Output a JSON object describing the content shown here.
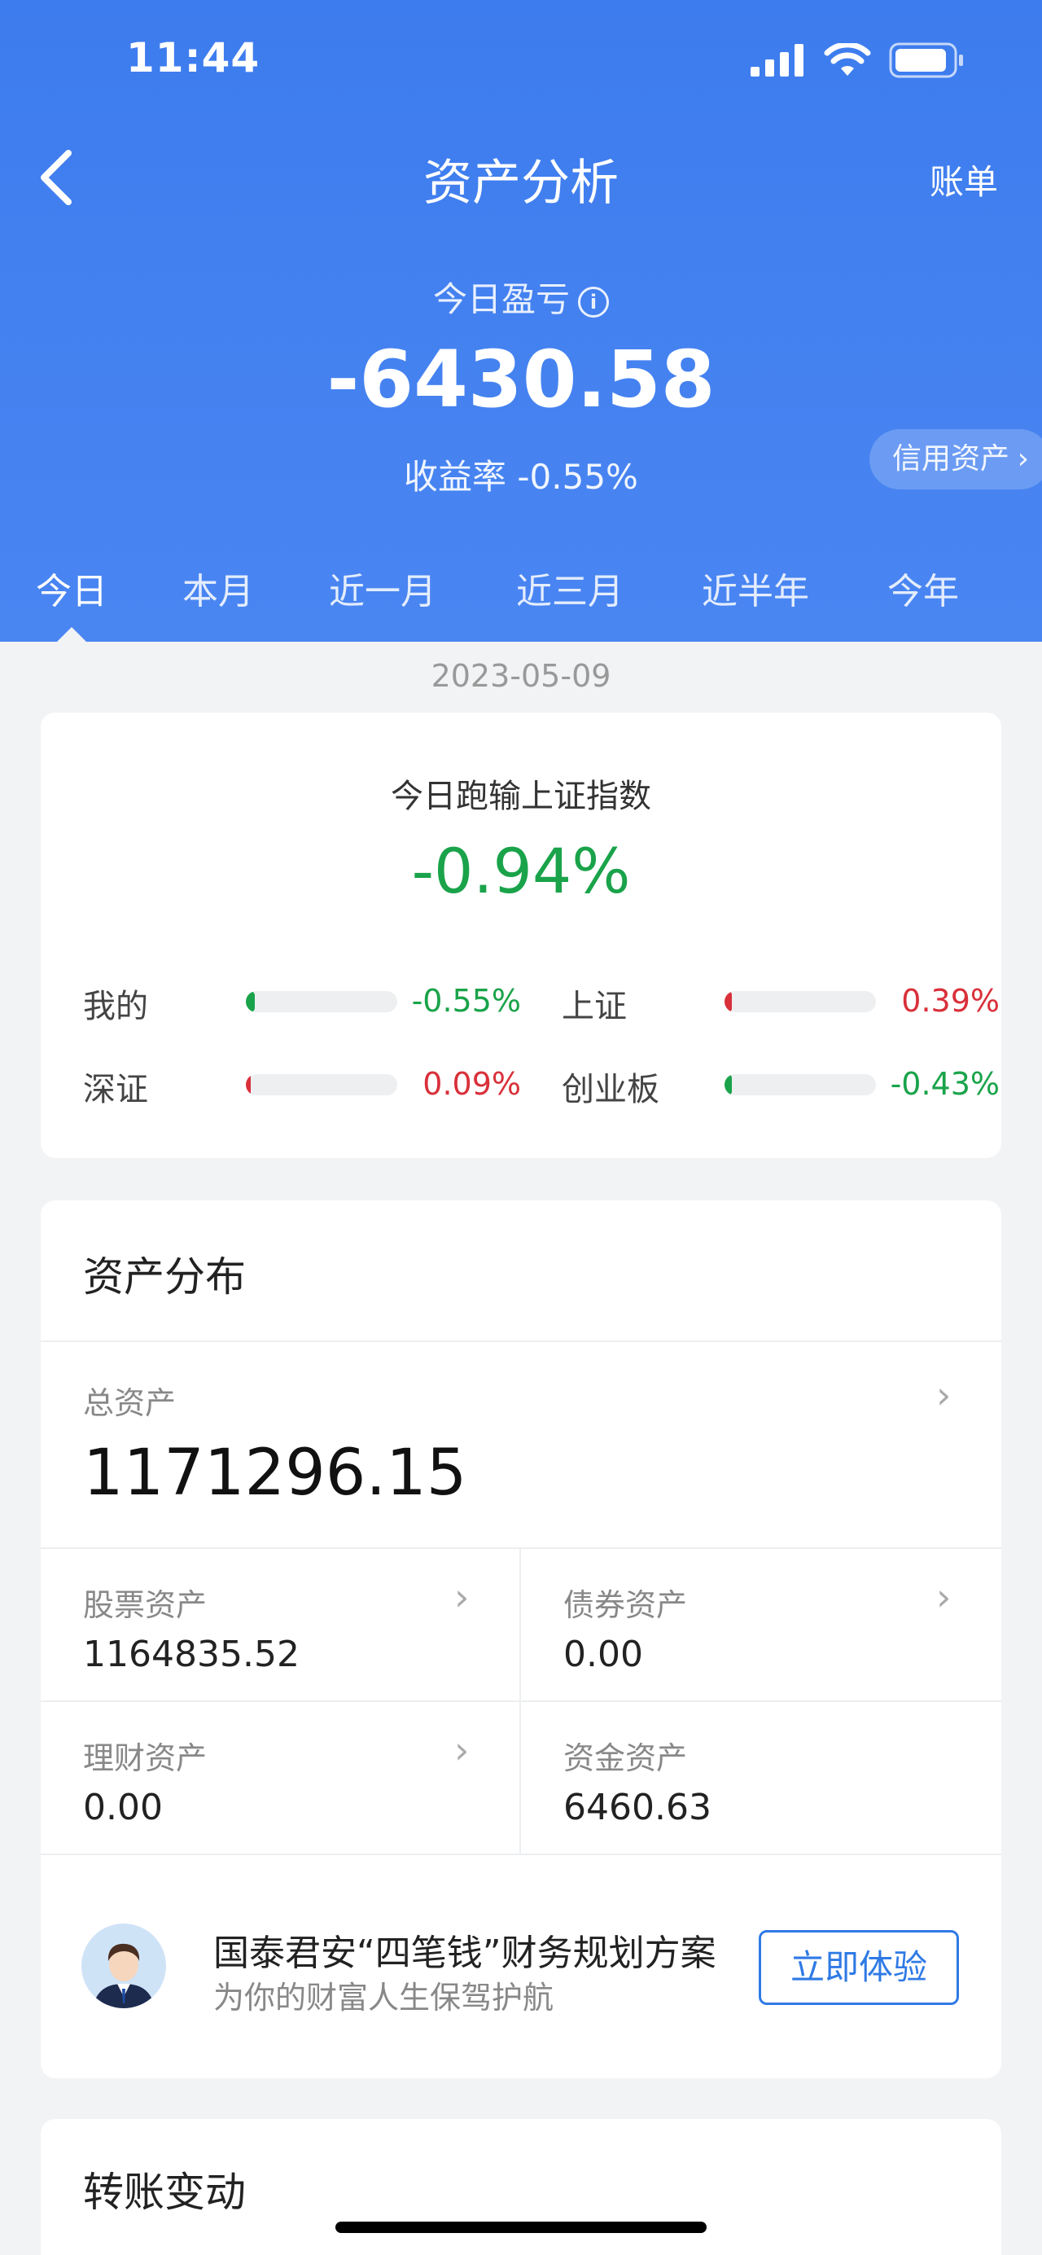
{
  "status_bar": {
    "time": "11:44"
  },
  "nav": {
    "title": "资产分析",
    "bill_label": "账单"
  },
  "summary": {
    "pl_label": "今日盈亏",
    "info_glyph": "i",
    "pl_value": "-6430.58",
    "yield_text": "收益率 -0.55%",
    "credit_label": "信用资产",
    "credit_chevron": "›"
  },
  "tabs": [
    "今日",
    "本月",
    "近一月",
    "近三月",
    "近半年",
    "今年"
  ],
  "active_tab": "今日",
  "date": "2023-05-09",
  "comparison": {
    "title": "今日跑输上证指数",
    "value": "-0.94%",
    "rows": [
      {
        "name": "我的",
        "pct": "-0.55%",
        "color": "#1aa34a",
        "level": 0.06
      },
      {
        "name": "上证",
        "pct": "0.39%",
        "color": "#d9303a",
        "level": 0.05
      },
      {
        "name": "深证",
        "pct": "0.09%",
        "color": "#d9303a",
        "level": 0.01
      },
      {
        "name": "创业板",
        "pct": "-0.43%",
        "color": "#1aa34a",
        "level": 0.05
      }
    ]
  },
  "assets": {
    "title": "资产分布",
    "total_label": "总资产",
    "total_value": "1171296.15",
    "chevron": "›",
    "cells": [
      {
        "label": "股票资产",
        "value": "1164835.52"
      },
      {
        "label": "债券资产",
        "value": "0.00"
      },
      {
        "label": "理财资产",
        "value": "0.00"
      },
      {
        "label": "资金资产",
        "value": "6460.63"
      }
    ]
  },
  "promo": {
    "title": "国泰君安“四笔钱”财务规划方案",
    "subtitle": "为你的财富人生保驾护航",
    "button": "立即体验"
  },
  "transfer": {
    "title": "转账变动"
  },
  "colors": {
    "header_blue": "#3d7cee",
    "green": "#1aa34a",
    "red": "#d9303a",
    "link_blue": "#2f7ae5"
  }
}
